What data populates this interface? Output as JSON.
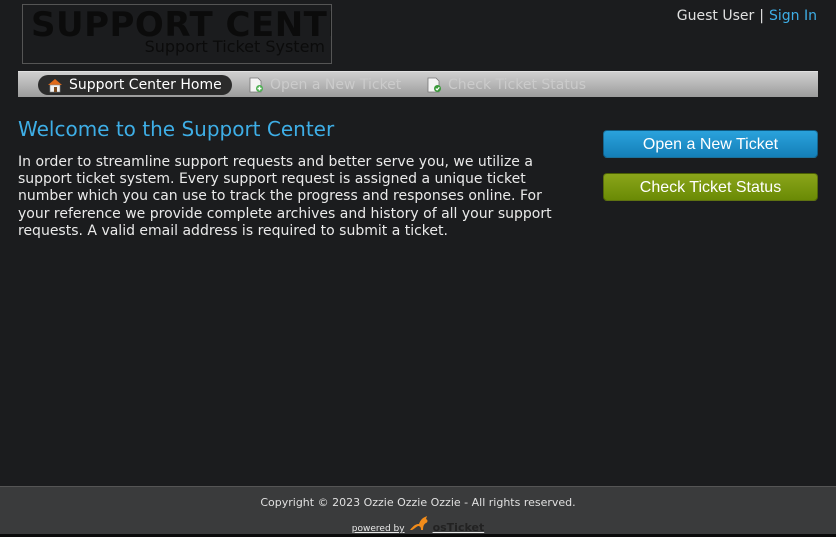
{
  "header": {
    "logo_title": "SUPPORT CENTER",
    "logo_subtitle": "Support Ticket System",
    "guest_label": "Guest User",
    "separator": "|",
    "sign_in_label": "Sign In"
  },
  "nav": {
    "items": [
      {
        "label": "Support Center Home",
        "icon": "home-icon",
        "active": true
      },
      {
        "label": "Open a New Ticket",
        "icon": "new-ticket-icon",
        "active": false
      },
      {
        "label": "Check Ticket Status",
        "icon": "ticket-status-icon",
        "active": false
      }
    ]
  },
  "main": {
    "title": "Welcome to the Support Center",
    "intro": "In order to streamline support requests and better serve you, we utilize a support ticket system. Every support request is assigned a unique ticket number which you can use to track the progress and responses online. For your reference we provide complete archives and history of all your support requests. A valid email address is required to submit a ticket."
  },
  "sidebar": {
    "open_ticket_label": "Open a New Ticket",
    "check_status_label": "Check Ticket Status"
  },
  "footer": {
    "copyright": "Copyright © 2023 Ozzie Ozzie Ozzie - All rights reserved.",
    "powered_by": "powered by",
    "brand": "osTicket"
  },
  "colors": {
    "accent_blue": "#3eaee6",
    "button_blue": "#1a8fcb",
    "button_green": "#7a9810",
    "background": "#1b1c1e"
  }
}
